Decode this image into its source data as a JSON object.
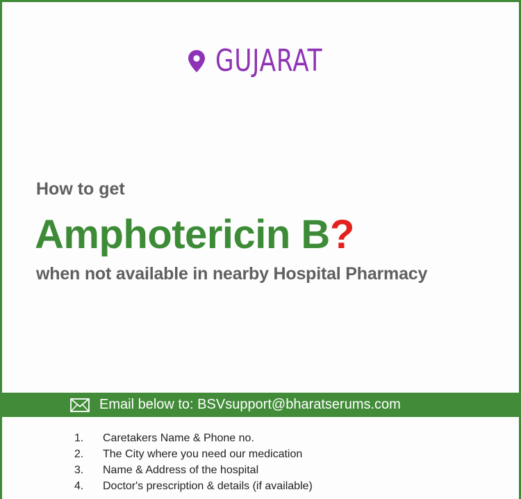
{
  "location": {
    "icon": "location-pin-icon",
    "label": "GUJARAT",
    "color": "#8e33b5"
  },
  "heading": {
    "lead": "How to get",
    "drug_name": "Amphotericin B",
    "question_mark": "?",
    "subtitle": "when not available in nearby Hospital Pharmacy"
  },
  "email_bar": {
    "icon": "envelope-icon",
    "text": "Email below to: BSVsupport@bharatserums.com"
  },
  "requirements": [
    {
      "num": "1.",
      "text": "Caretakers Name & Phone no."
    },
    {
      "num": "2.",
      "text": "The City where you need our medication"
    },
    {
      "num": "3.",
      "text": "Name & Address of the hospital"
    },
    {
      "num": "4.",
      "text": "Doctor's prescription & details (if available)"
    }
  ],
  "colors": {
    "accent_green": "#3d8b37",
    "question_red": "#e3201b",
    "gray_text": "#5f5f5f"
  }
}
